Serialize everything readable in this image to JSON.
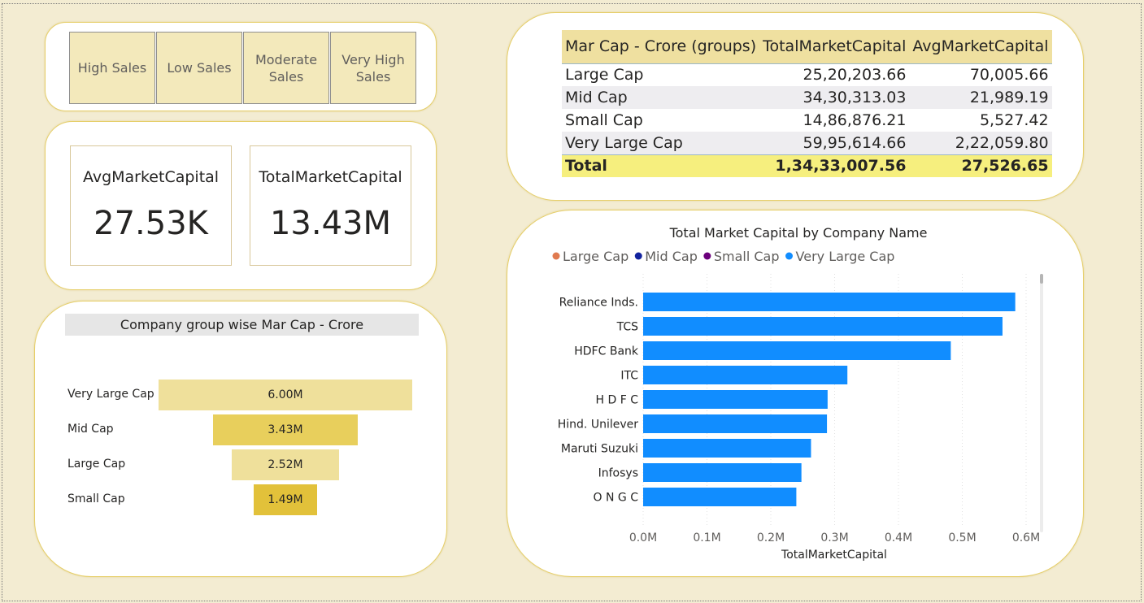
{
  "slicer": {
    "options": [
      "High Sales",
      "Low Sales",
      "Moderate Sales",
      "Very High Sales"
    ]
  },
  "cards": [
    {
      "title": "AvgMarketCapital",
      "value": "27.53K"
    },
    {
      "title": "TotalMarketCapital",
      "value": "13.43M"
    }
  ],
  "funnel": {
    "title": "Company group wise Mar Cap - Crore",
    "rows": [
      {
        "label": "Very Large Cap",
        "value_label": "6.00M",
        "value": 5995614.66,
        "color": "#efe09b"
      },
      {
        "label": "Mid Cap",
        "value_label": "3.43M",
        "value": 3430313.03,
        "color": "#e8cf5c"
      },
      {
        "label": "Large Cap",
        "value_label": "2.52M",
        "value": 2520203.66,
        "color": "#efe09b"
      },
      {
        "label": "Small Cap",
        "value_label": "1.49M",
        "value": 1486876.21,
        "color": "#e2c13a"
      }
    ]
  },
  "table": {
    "headers": [
      "Mar Cap - Crore (groups)",
      "TotalMarketCapital",
      "AvgMarketCapital"
    ],
    "rows": [
      [
        "Large Cap",
        "25,20,203.66",
        "70,005.66"
      ],
      [
        "Mid Cap",
        "34,30,313.03",
        "21,989.19"
      ],
      [
        "Small Cap",
        "14,86,876.21",
        "5,527.42"
      ],
      [
        "Very Large Cap",
        "59,95,614.66",
        "2,22,059.80"
      ]
    ],
    "total": [
      "Total",
      "1,34,33,007.56",
      "27,526.65"
    ]
  },
  "chart_data": {
    "type": "bar",
    "orientation": "horizontal",
    "title": "Total Market Capital by Company Name",
    "xlabel": "TotalMarketCapital",
    "ylabel": "",
    "xlim": [
      0,
      0.6
    ],
    "xticks": [
      "0.0M",
      "0.1M",
      "0.2M",
      "0.3M",
      "0.4M",
      "0.5M",
      "0.6M"
    ],
    "grid": true,
    "legend": {
      "position": "top-left",
      "items": [
        {
          "label": "Large Cap",
          "color": "#e07a4f"
        },
        {
          "label": "Mid Cap",
          "color": "#12239e"
        },
        {
          "label": "Small Cap",
          "color": "#6b007b"
        },
        {
          "label": "Very Large Cap",
          "color": "#118dff"
        }
      ]
    },
    "bar_color": "#118dff",
    "categories": [
      "Reliance Inds.",
      "TCS",
      "HDFC Bank",
      "ITC",
      "H D F C",
      "Hind. Unilever",
      "Maruti Suzuki",
      "Infosys",
      "O N G C"
    ],
    "values": [
      0.583,
      0.563,
      0.482,
      0.32,
      0.289,
      0.288,
      0.263,
      0.248,
      0.24
    ],
    "value_unit": "M"
  }
}
